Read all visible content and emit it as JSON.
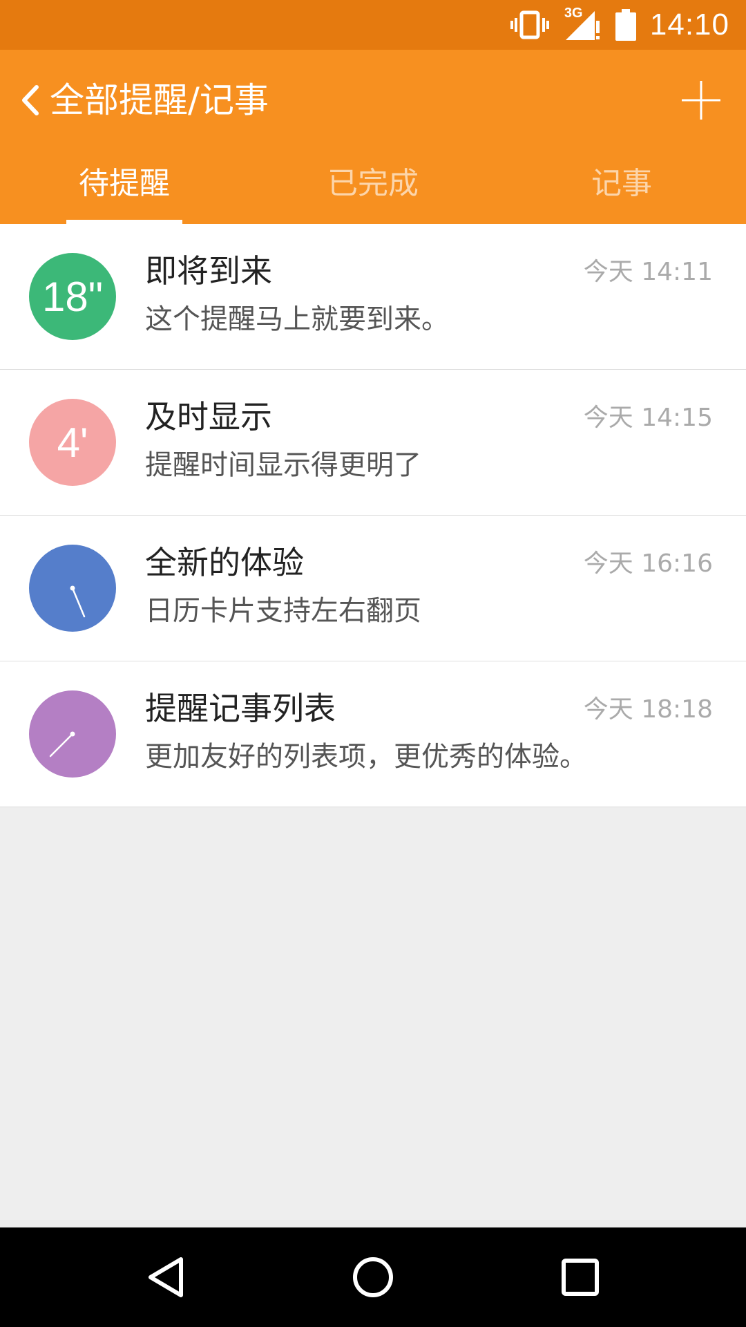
{
  "status_bar": {
    "network": "3G",
    "time": "14:10"
  },
  "header": {
    "title": "全部提醒/记事",
    "back_icon": "chevron-left-icon",
    "add_icon": "plus-icon"
  },
  "tabs": [
    {
      "label": "待提醒",
      "active": true
    },
    {
      "label": "已完成",
      "active": false
    },
    {
      "label": "记事",
      "active": false
    }
  ],
  "items": [
    {
      "badge": "18\"",
      "badge_type": "text",
      "color": "#3cb878",
      "title": "即将到来",
      "subtitle": "这个提醒马上就要到来。",
      "time": "今天 14:11"
    },
    {
      "badge": "4'",
      "badge_type": "text",
      "color": "#f5a5a5",
      "title": "及时显示",
      "subtitle": "提醒时间显示得更明了",
      "time": "今天 14:15"
    },
    {
      "badge": "",
      "badge_type": "clock",
      "color": "#557ecb",
      "title": "全新的体验",
      "subtitle": "日历卡片支持左右翻页",
      "time": "今天 16:16"
    },
    {
      "badge": "",
      "badge_type": "clock",
      "color": "#b47fc4",
      "title": "提醒记事列表",
      "subtitle": "更加友好的列表项，更优秀的体验。",
      "time": "今天 18:18"
    }
  ],
  "colors": {
    "status_bar": "#e57a0f",
    "header": "#f79020",
    "background": "#eeeeee"
  }
}
